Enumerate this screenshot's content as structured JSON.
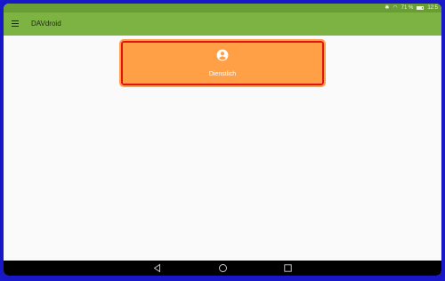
{
  "status_bar": {
    "battery_percent": "71 %",
    "time": "12:5"
  },
  "app_bar": {
    "title": "DAVdroid"
  },
  "accounts": [
    {
      "name": "Dienstlich",
      "icon": "account-circle-icon"
    }
  ],
  "fab": {
    "icon": "plus-icon"
  },
  "nav_bar": {
    "buttons": [
      "back-icon",
      "home-icon",
      "recents-icon"
    ]
  },
  "colors": {
    "status_bar": "#6a9e35",
    "app_bar": "#7cb342",
    "card": "#ffa047",
    "card_highlight": "#e01414",
    "fab": "#ff6d00",
    "frame": "#1818c8"
  }
}
